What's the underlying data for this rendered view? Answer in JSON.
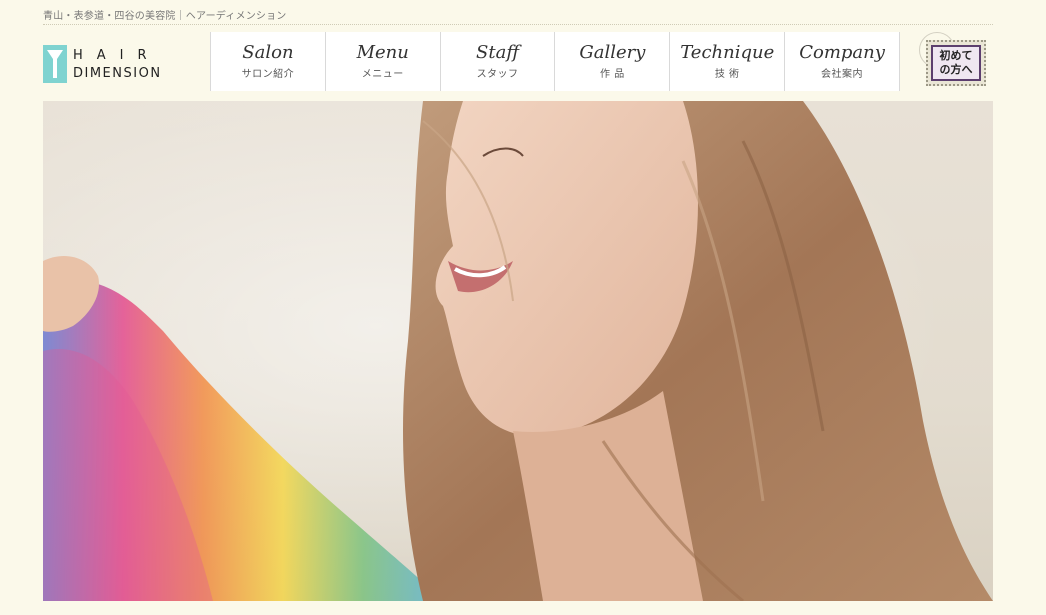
{
  "header": {
    "tagline": "青山・表参道・四谷の美容院｜ヘアーディメンション",
    "logo": {
      "line1": "HAIR",
      "line2": "DIMENSION"
    }
  },
  "nav": {
    "items": [
      {
        "en": "Salon",
        "ja": "サロン紹介"
      },
      {
        "en": "Menu",
        "ja": "メニュー"
      },
      {
        "en": "Staff",
        "ja": "スタッフ"
      },
      {
        "en": "Gallery",
        "ja": "作 品"
      },
      {
        "en": "Technique",
        "ja": "技 術"
      },
      {
        "en": "Company",
        "ja": "会社案内"
      }
    ]
  },
  "first_visit": {
    "label": "初めて\nの方へ"
  },
  "colors": {
    "background": "#fbf9ea",
    "logo_mark": "#7fd3d0",
    "stamp_border": "#5c3f6e"
  }
}
